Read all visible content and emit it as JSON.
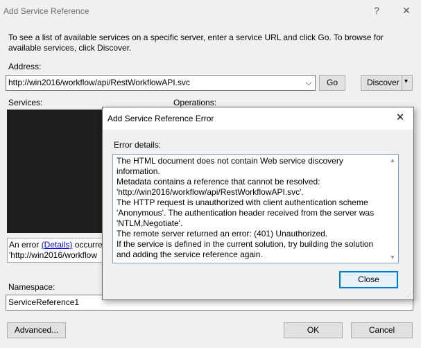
{
  "window": {
    "title": "Add Service Reference",
    "help_glyph": "?",
    "close_glyph": "✕"
  },
  "intro_text": "To see a list of available services on a specific server, enter a service URL and click Go. To browse for available services, click Discover.",
  "address": {
    "label": "Address:",
    "value": "http://win2016/workflow/api/RestWorkflowAPI.svc",
    "dropdown_glyph": "⌵"
  },
  "go_label": "Go",
  "discover": {
    "label": "Discover",
    "arrow": "▾"
  },
  "services_label": "Services:",
  "operations_label": "Operations:",
  "status": {
    "prefix": "An error ",
    "link": "(Details)",
    "suffix": " occurred",
    "line2": "'http://win2016/workflow"
  },
  "namespace": {
    "label": "Namespace:",
    "value": "ServiceReference1"
  },
  "buttons": {
    "advanced": "Advanced...",
    "ok": "OK",
    "cancel": "Cancel"
  },
  "error_dialog": {
    "title": "Add Service Reference Error",
    "close_glyph": "✕",
    "details_label": "Error details:",
    "message": "The HTML document does not contain Web service discovery information.\nMetadata contains a reference that cannot be resolved: 'http://win2016/workflow/api/RestWorkflowAPI.svc'.\nThe HTTP request is unauthorized with client authentication scheme 'Anonymous'. The authentication header received from the server was 'NTLM,Negotiate'.\nThe remote server returned an error: (401) Unauthorized.\nIf the service is defined in the current solution, try building the solution and adding the service reference again.",
    "scroll_up": "▲",
    "scroll_down": "▼",
    "close_button": "Close",
    "grip": "⋰"
  }
}
